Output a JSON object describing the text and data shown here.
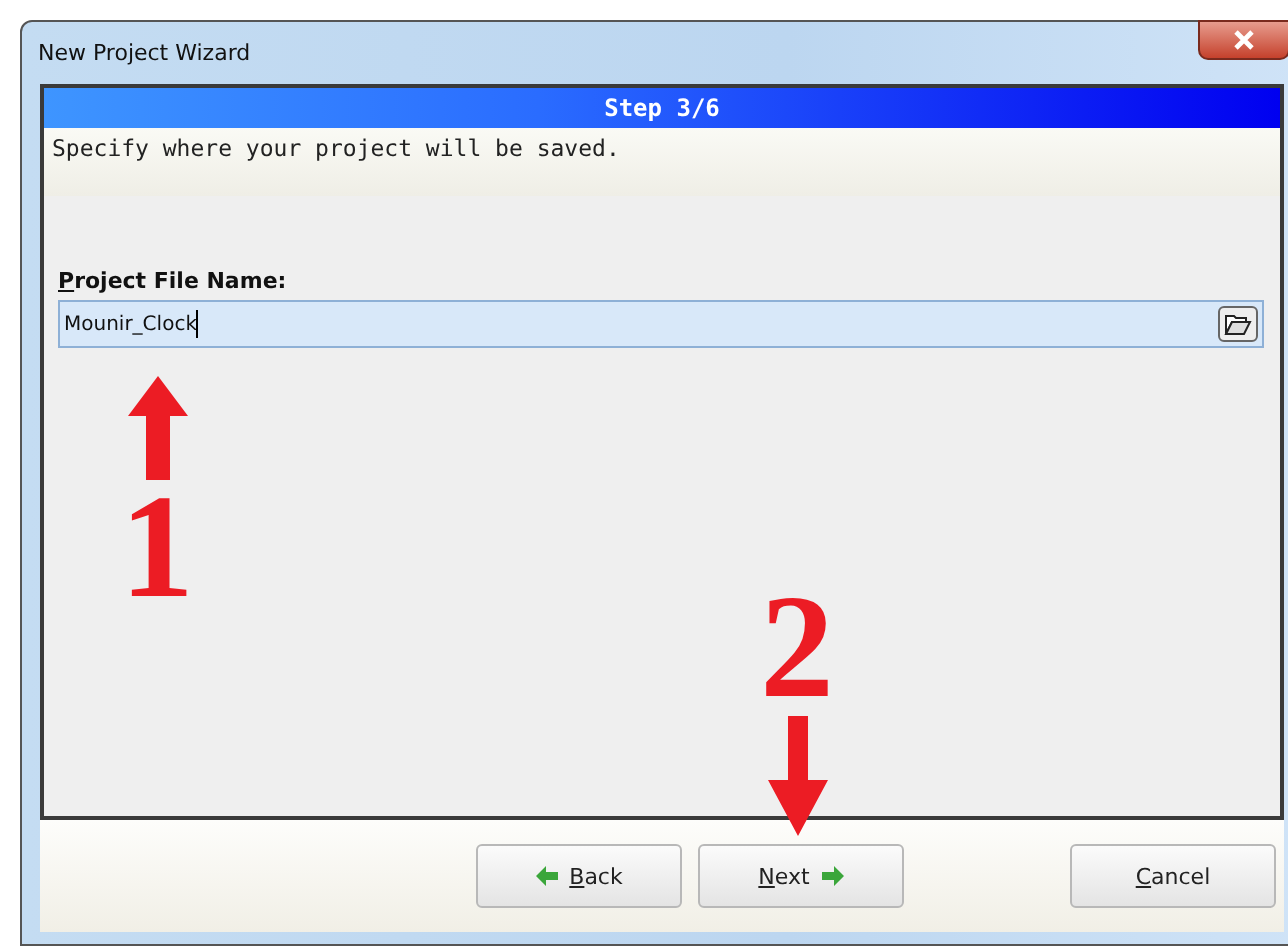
{
  "window": {
    "title": "New Project Wizard"
  },
  "step": {
    "title": "Step 3/6",
    "description": "Specify where your project will be saved."
  },
  "field": {
    "label": "Project File Name:",
    "label_underline_first": true,
    "value": "Mounir_Clock"
  },
  "buttons": [
    {
      "kind": "back",
      "label": "Back",
      "underline_first": true
    },
    {
      "kind": "next",
      "label": "Next",
      "underline_first": true
    },
    {
      "kind": "cancel",
      "label": "Cancel",
      "underline_first": true
    }
  ],
  "annotations": [
    {
      "text": "1",
      "kind": "up"
    },
    {
      "text": "2",
      "kind": "down"
    }
  ]
}
